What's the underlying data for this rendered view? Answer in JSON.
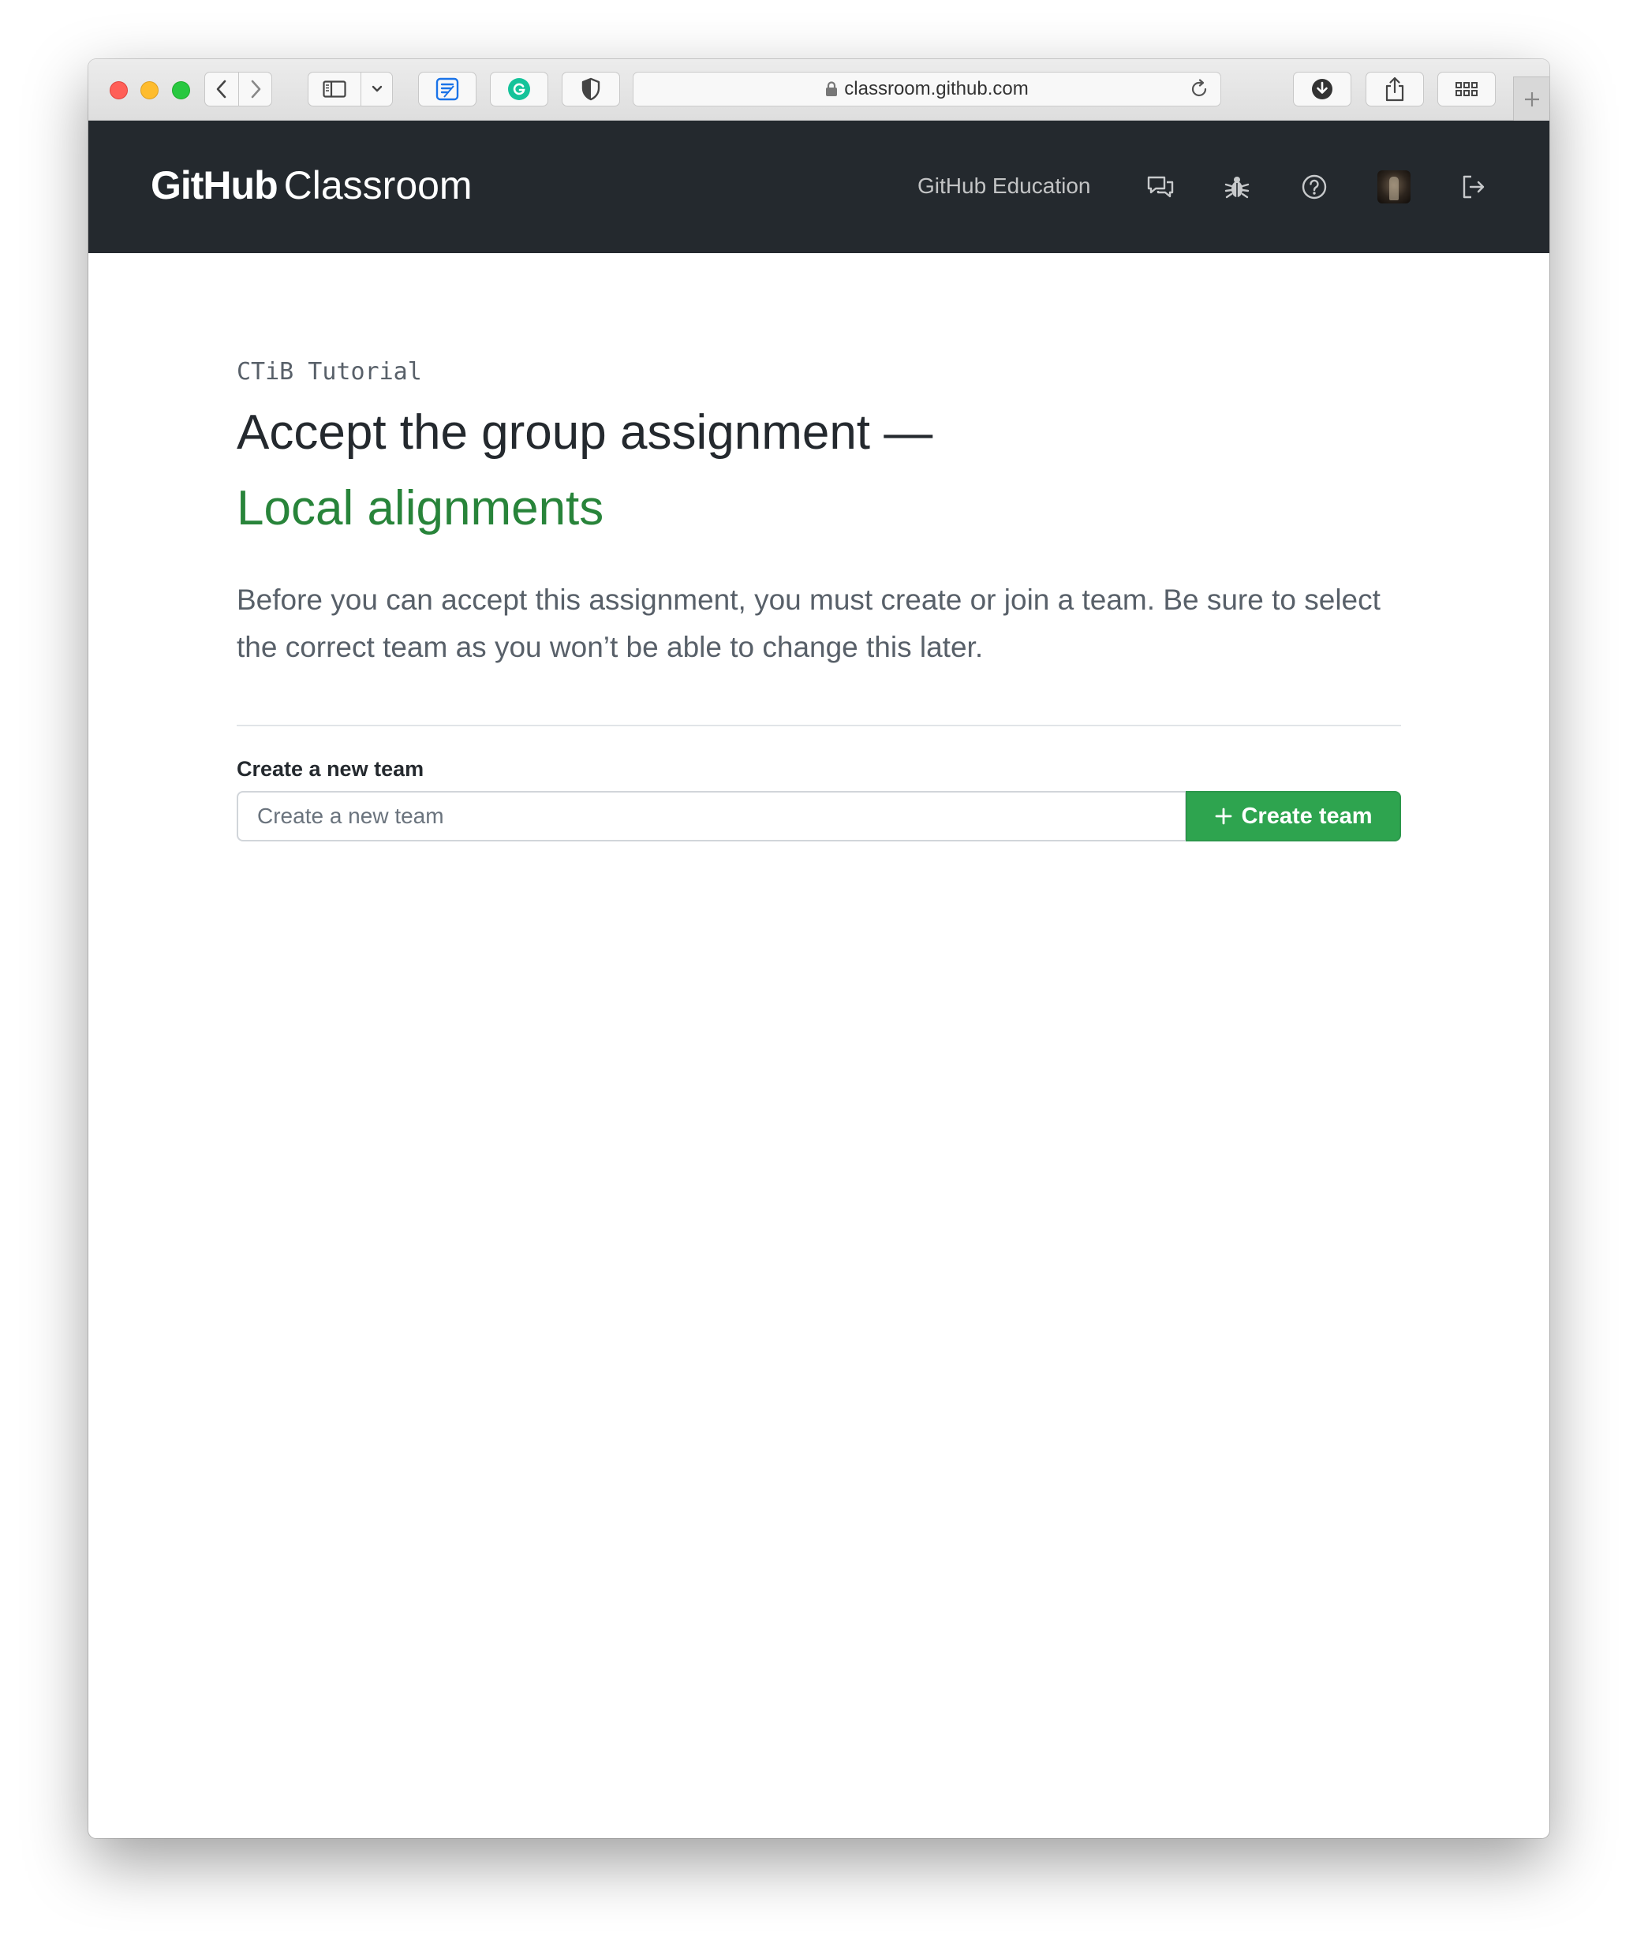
{
  "browser": {
    "url": "classroom.github.com",
    "icons": {
      "back": "chevron-left-icon",
      "forward": "chevron-right-icon",
      "sidebar": "sidebar-icon",
      "sidebar_menu": "chevron-down-icon",
      "extension1": "notes-extension-icon",
      "extension2": "grammarly-icon",
      "extension3": "shield-icon",
      "lock": "lock-icon",
      "reload": "reload-icon",
      "download": "download-icon",
      "share": "share-icon",
      "tabs": "tab-overview-icon",
      "new_tab": "plus-icon"
    }
  },
  "header": {
    "logo_bold": "GitHub",
    "logo_light": "Classroom",
    "nav_link": "GitHub Education",
    "icons": [
      "comment-discussion-icon",
      "bug-icon",
      "question-icon",
      "avatar",
      "sign-out-icon"
    ],
    "background": "#24292e"
  },
  "main": {
    "eyebrow": "CTiB Tutorial",
    "title": "Accept the group assignment —",
    "assignment_name": "Local alignments",
    "lead": "Before you can accept this assignment, you must create or join a team. Be sure to select the correct team as you won’t be able to change this later.",
    "form": {
      "label": "Create a new team",
      "placeholder": "Create a new team",
      "value": "",
      "button_label": "Create team"
    }
  },
  "colors": {
    "accent_green": "#2ea44f",
    "assignment_green": "#28843a",
    "text_muted": "#586069"
  }
}
